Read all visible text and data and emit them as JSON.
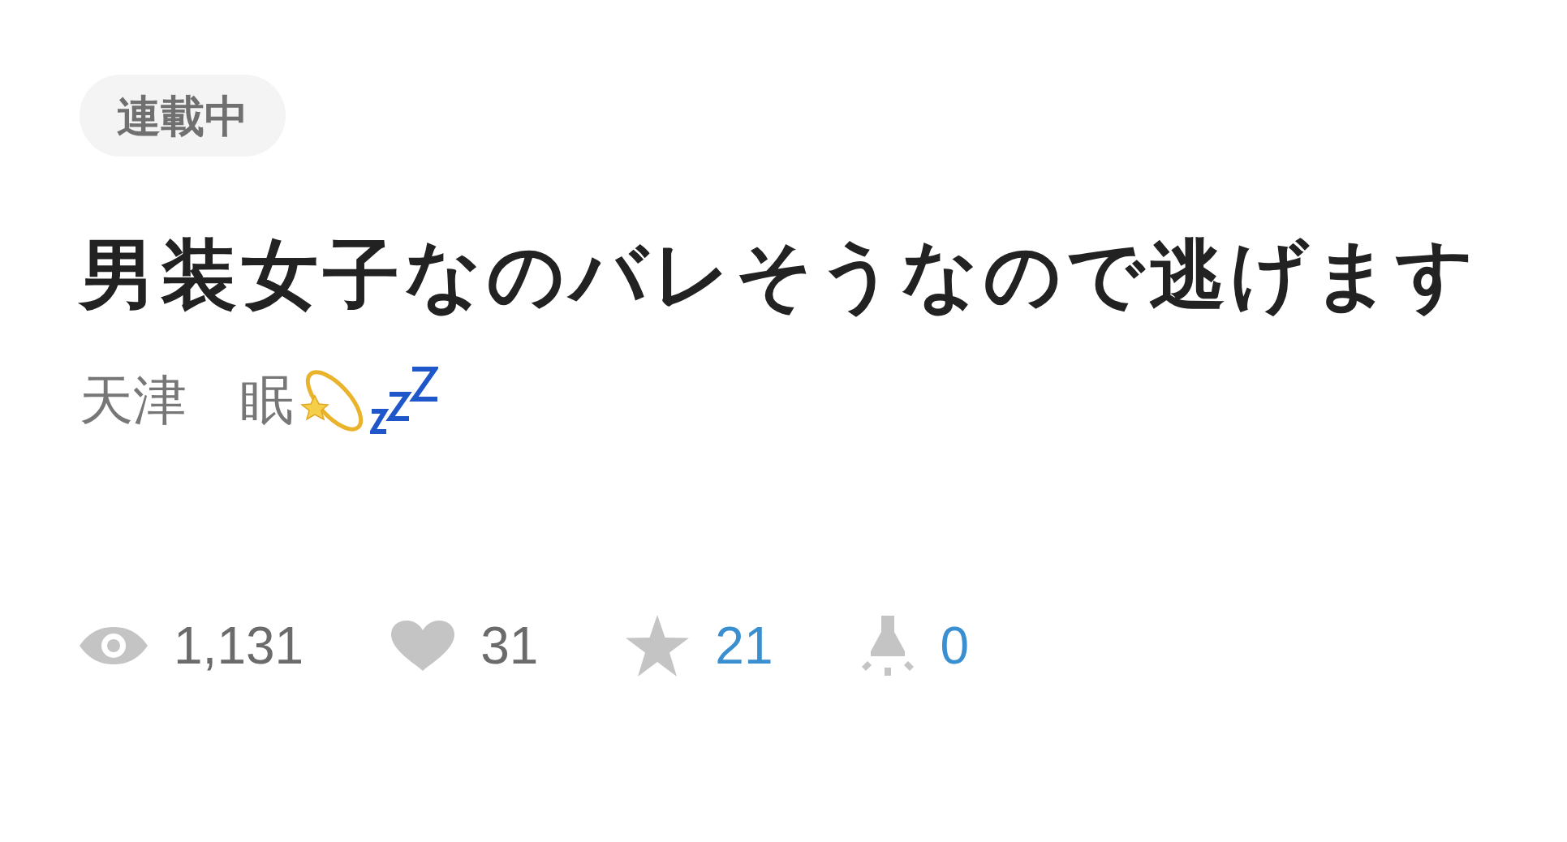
{
  "status_badge": "連載中",
  "title": "男装女子なのバレそうなので逃げます",
  "author": {
    "name": "天津　眠"
  },
  "stats": [
    {
      "kind": "views",
      "value": "1,131",
      "color": "#6b6b6b"
    },
    {
      "kind": "likes",
      "value": "31",
      "color": "#6b6b6b"
    },
    {
      "kind": "stars",
      "value": "21",
      "color": "#3a8fd0"
    },
    {
      "kind": "lamps",
      "value": "0",
      "color": "#3a8fd0"
    }
  ]
}
